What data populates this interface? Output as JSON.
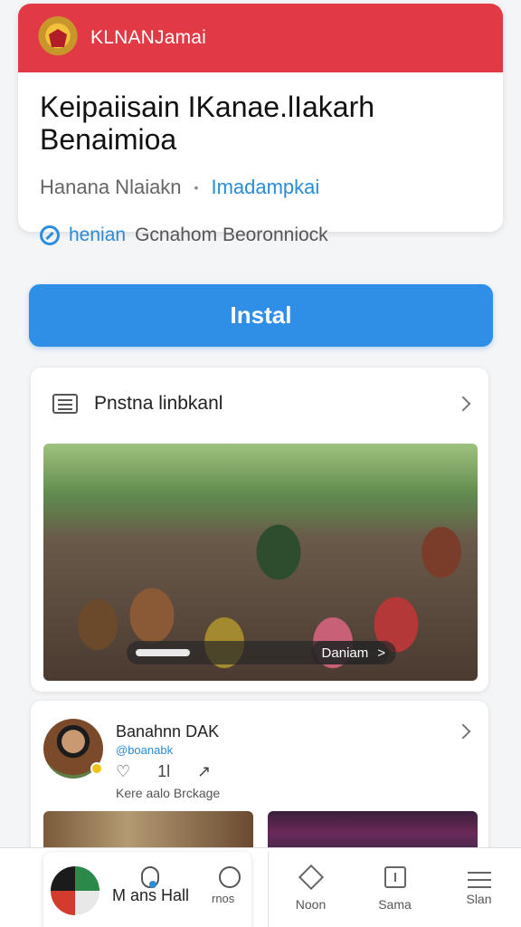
{
  "app": {
    "name": "KLNANJamai",
    "title_line1": "Keipaiisain IKanae.lIakarh",
    "title_line2": "Benaimioa",
    "developer": "Hanana Nlaiakn",
    "category": "Imadampkai",
    "emblem_icon": "garuda-emblem-icon",
    "brand_color": "#e23a44"
  },
  "verified": {
    "icon": "shield-check-icon",
    "link_text": "henian",
    "text": "Gcnahom Beoronniock"
  },
  "install": {
    "label": "Instal",
    "color": "#2f8ee6"
  },
  "news": {
    "title": "Pnstna linbkanl",
    "more_label": "Daniam",
    "more_arrow": ">"
  },
  "profile": {
    "name": "Banahnn DAK",
    "handle": "@boanabk",
    "actions": [
      "♡",
      "1l",
      "↗"
    ],
    "subtitle": "Kere aalo Brckage"
  },
  "bottom_nav": {
    "featured_text": "M ans Hall",
    "side_label": "rnos",
    "tabs": [
      {
        "label": "Noon",
        "icon": "diamond-icon"
      },
      {
        "label": "Sama",
        "icon": "info-box-icon"
      },
      {
        "label": "Slan",
        "icon": "menu-icon"
      }
    ]
  }
}
